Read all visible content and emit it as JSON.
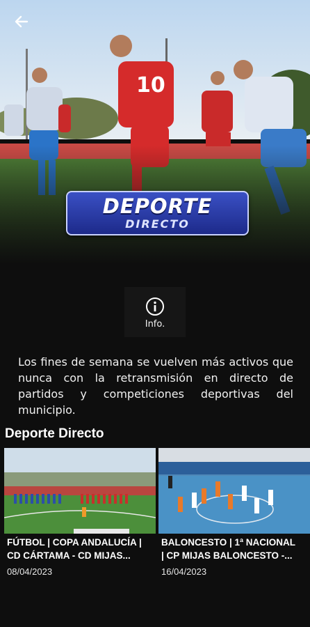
{
  "header": {
    "back_icon": "arrow-left-icon",
    "banner_logo": {
      "line1": "DEPORTE",
      "line2": "DIRECTO"
    }
  },
  "info_button": {
    "icon": "info-icon",
    "label": "Info."
  },
  "description": "Los fines de semana se vuelven más activos que nunca con la retransmisión en directo de partidos y competiciones deportivas del municipio.",
  "section": {
    "title": "Deporte Directo",
    "items": [
      {
        "title_line1": "FÚTBOL | COPA ANDALUCÍA |",
        "title_line2": "CD CÁRTAMA - CD MIJAS...",
        "date": "08/04/2023"
      },
      {
        "title_line1": "BALONCESTO | 1ª NACIONAL",
        "title_line2": "| CP MIJAS BALONCESTO -...",
        "date": "16/04/2023"
      }
    ]
  },
  "colors": {
    "background": "#0e0e0e",
    "logo_blue": "#2a3db0"
  }
}
